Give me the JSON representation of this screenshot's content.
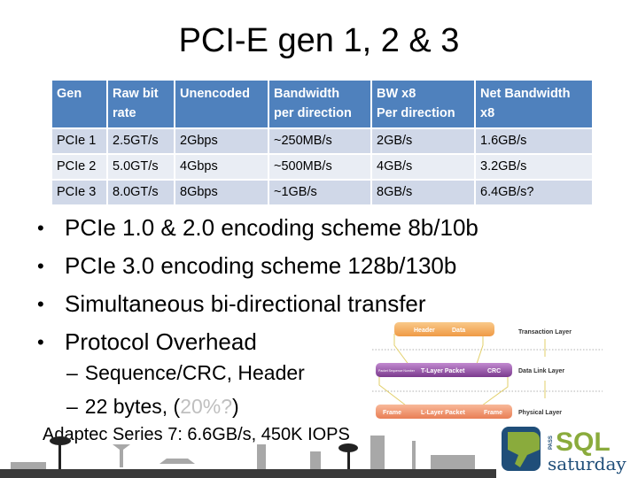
{
  "slide": {
    "title": "PCI-E gen 1, 2 & 3"
  },
  "table": {
    "headers": [
      "Gen",
      "Raw bit rate",
      "Unencoded",
      "Bandwidth per direction",
      "BW x8 Per direction",
      "Net Bandwidth x8"
    ],
    "header_lines": [
      [
        "Gen",
        ""
      ],
      [
        "Raw bit",
        "rate"
      ],
      [
        "Unencoded",
        ""
      ],
      [
        "Bandwidth",
        "per direction"
      ],
      [
        "BW x8",
        "Per direction"
      ],
      [
        "Net Bandwidth",
        "x8"
      ]
    ],
    "rows": [
      [
        "PCIe 1",
        "2.5GT/s",
        "2Gbps",
        "~250MB/s",
        "2GB/s",
        "1.6GB/s"
      ],
      [
        "PCIe 2",
        "5.0GT/s",
        "4Gbps",
        "~500MB/s",
        "4GB/s",
        "3.2GB/s"
      ],
      [
        "PCIe 3",
        "8.0GT/s",
        "8Gbps",
        "~1GB/s",
        "8GB/s",
        "6.4GB/s?"
      ]
    ],
    "colors": {
      "header": "#4f81bd",
      "row_dark": "#d0d8e8",
      "row_light": "#e9edf4"
    }
  },
  "bullets": [
    "PCIe 1.0 & 2.0 encoding scheme 8b/10b",
    "PCIe 3.0 encoding scheme 128b/130b",
    "Simultaneous bi-directional transfer",
    "Protocol Overhead"
  ],
  "bullet_glyph": "•",
  "sub_bullets": {
    "dash": "–",
    "items": [
      {
        "text": "Sequence/CRC, Header",
        "note": ""
      },
      {
        "text": "22 bytes, (",
        "note": "20%?",
        "tail": ")"
      }
    ]
  },
  "footer_note": "Adaptec Series 7: 6.6GB/s, 450K IOPS",
  "diagram": {
    "layers": [
      "Transaction Layer",
      "Data Link Layer",
      "Physical Layer"
    ],
    "transaction_blocks": [
      "Header",
      "Data"
    ],
    "datalink_blocks": [
      "Packet Sequence Number",
      "T-Layer Packet",
      "CRC"
    ],
    "physical_blocks": [
      "Frame",
      "L-Layer Packet",
      "Frame"
    ],
    "colors": {
      "transaction": "#f2a65a",
      "datalink": "#8e4a9e",
      "physical": "#ee8e64"
    }
  },
  "logo": {
    "pass": "PASS",
    "sql": "SQL",
    "saturday": "saturday",
    "colors": {
      "green": "#8aab3c",
      "blue": "#1f4e79"
    }
  }
}
